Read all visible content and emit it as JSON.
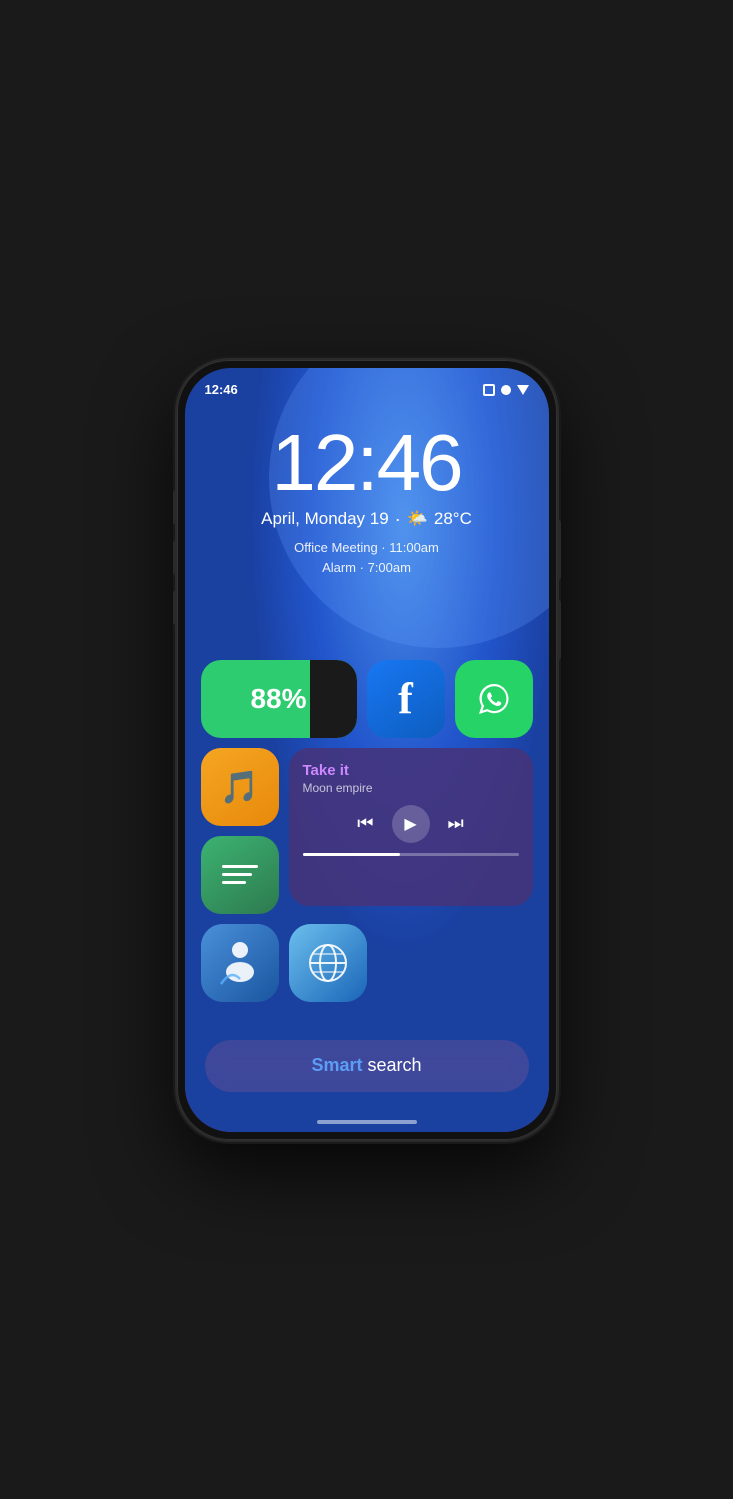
{
  "status": {
    "time": "12:46"
  },
  "clock": {
    "time": "12:46",
    "date": "April, Monday 19",
    "weather_icon": "🌤️",
    "temp": "28°C",
    "event1": "Office Meeting · 11:00am",
    "event2": "Alarm · 7:00am"
  },
  "battery": {
    "percent": "88%"
  },
  "music": {
    "title": "Take it",
    "artist": "Moon empire"
  },
  "search": {
    "smart_label": "Smart",
    "search_label": " search"
  },
  "apps": {
    "facebook_label": "Facebook",
    "whatsapp_label": "WhatsApp",
    "music_label": "Music",
    "notes_label": "Notes",
    "phone_label": "Phone",
    "browser_label": "Browser"
  }
}
